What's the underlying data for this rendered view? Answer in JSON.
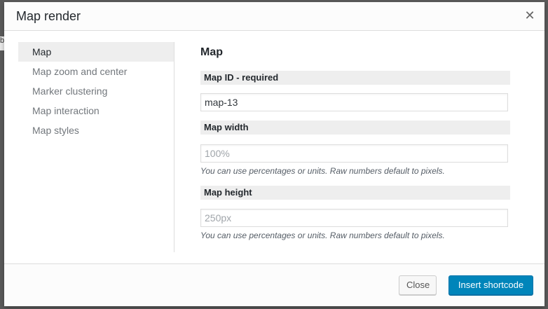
{
  "modal": {
    "title": "Map render",
    "close_icon": "close-icon"
  },
  "sidebar": {
    "items": [
      {
        "label": "Map",
        "active": true
      },
      {
        "label": "Map zoom and center",
        "active": false
      },
      {
        "label": "Marker clustering",
        "active": false
      },
      {
        "label": "Map interaction",
        "active": false
      },
      {
        "label": "Map styles",
        "active": false
      }
    ]
  },
  "main": {
    "section_title": "Map",
    "fields": [
      {
        "label": "Map ID - required",
        "value": "map-13",
        "placeholder": "",
        "help": ""
      },
      {
        "label": "Map width",
        "value": "",
        "placeholder": "100%",
        "help": "You can use percentages or units. Raw numbers default to pixels."
      },
      {
        "label": "Map height",
        "value": "",
        "placeholder": "250px",
        "help": "You can use percentages or units. Raw numbers default to pixels."
      }
    ]
  },
  "footer": {
    "close_label": "Close",
    "insert_label": "Insert shortcode"
  },
  "colors": {
    "primary": "#0085ba",
    "backdrop": "#5a5a5a"
  }
}
